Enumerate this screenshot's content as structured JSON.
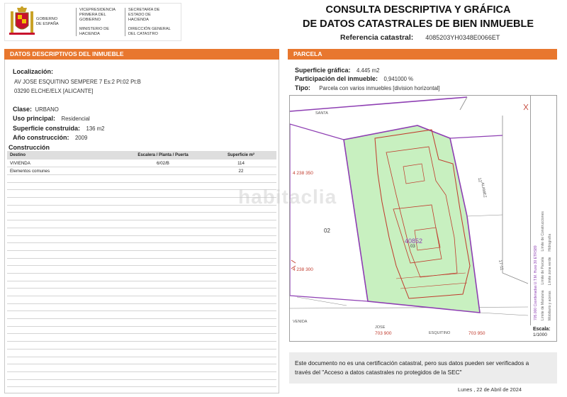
{
  "header": {
    "gov_left_1": "GOBIERNO",
    "gov_left_2": "DE ESPAÑA",
    "gov_mid_1": "VICEPRESIDENCIA PRIMERA DEL GOBIERNO",
    "gov_mid_2": "MINISTERIO DE HACIENDA",
    "gov_right_1": "SECRETARÍA DE ESTADO DE HACIENDA",
    "gov_right_2": "DIRECCIÓN GENERAL DEL CATASTRO",
    "title_line1": "CONSULTA DESCRIPTIVA Y GRÁFICA",
    "title_line2": "DE DATOS CATASTRALES DE BIEN INMUEBLE",
    "ref_label": "Referencia catastral:",
    "ref_value": "4085203YH0348E0066ET"
  },
  "left_panel": {
    "title": "DATOS DESCRIPTIVOS DEL INMUEBLE",
    "loc_label": "Localización:",
    "loc_line1": "AV JOSE ESQUITINO SEMPERE 7 Es:2 Pl:02 Pt:B",
    "loc_line2": "03290 ELCHE/ELX [ALICANTE]",
    "clase_label": "Clase:",
    "clase_value": "URBANO",
    "uso_label": "Uso principal:",
    "uso_value": "Residencial",
    "sup_label": "Superficie construida:",
    "sup_value": "136 m2",
    "anio_label": "Año construcción:",
    "anio_value": "2009",
    "constr_title": "Construcción",
    "table_headers": [
      "Destino",
      "Escalera / Planta / Puerta",
      "Superficie m²"
    ],
    "table_rows": [
      [
        "VIVIENDA",
        "6/02/B",
        "114"
      ],
      [
        "Elementos comunes",
        "",
        "22"
      ]
    ]
  },
  "right_panel": {
    "title": "PARCELA",
    "sup_label": "Superficie gráfica:",
    "sup_value": "4.445 m2",
    "part_label": "Participación del inmueble:",
    "part_value": "0,941000 %",
    "tipo_label": "Tipo:",
    "tipo_value": "Parcela con varios inmuebles [division horizontal]",
    "map": {
      "y_top": "4 238 350",
      "y_bottom": "4 238 300",
      "x_left": "703 900",
      "x_right": "703 950",
      "parcel_id": "40852",
      "parcel_sub": "03",
      "neighbor": "02",
      "street_top": "SANTA",
      "street_mid": "ALAMEZ",
      "street_bottom_1": "JOSE",
      "street_bottom_2": "ESQUITINO",
      "street_left": "VENIDA",
      "side_label_1": "12",
      "side_label_2": "17-11"
    },
    "legend": [
      "Límite de Manzana",
      "Límite de Parcela",
      "Límite de Construcciones",
      "Mobiliario y aceras",
      "Límite zona verde",
      "Hidrografía"
    ],
    "legend_coords": "705.000 Coordenadas U.T.M. Huso 30 ETRS89",
    "scale_label": "Escala:",
    "scale_value": "1/1000"
  },
  "notice": {
    "line1": "Este documento no es una certificación catastral, pero sus datos pueden ser verificados a",
    "line2": "través del \"Acceso a datos catastrales no protegidos de la SEC\""
  },
  "date": "Lunes , 22 de Abril de 2024",
  "watermark": "habitaclia",
  "colors": {
    "accent": "#e8772e",
    "parcel_fill": "#c8f0c0",
    "boundary": "#8e3fb3",
    "building": "#c0392b"
  }
}
